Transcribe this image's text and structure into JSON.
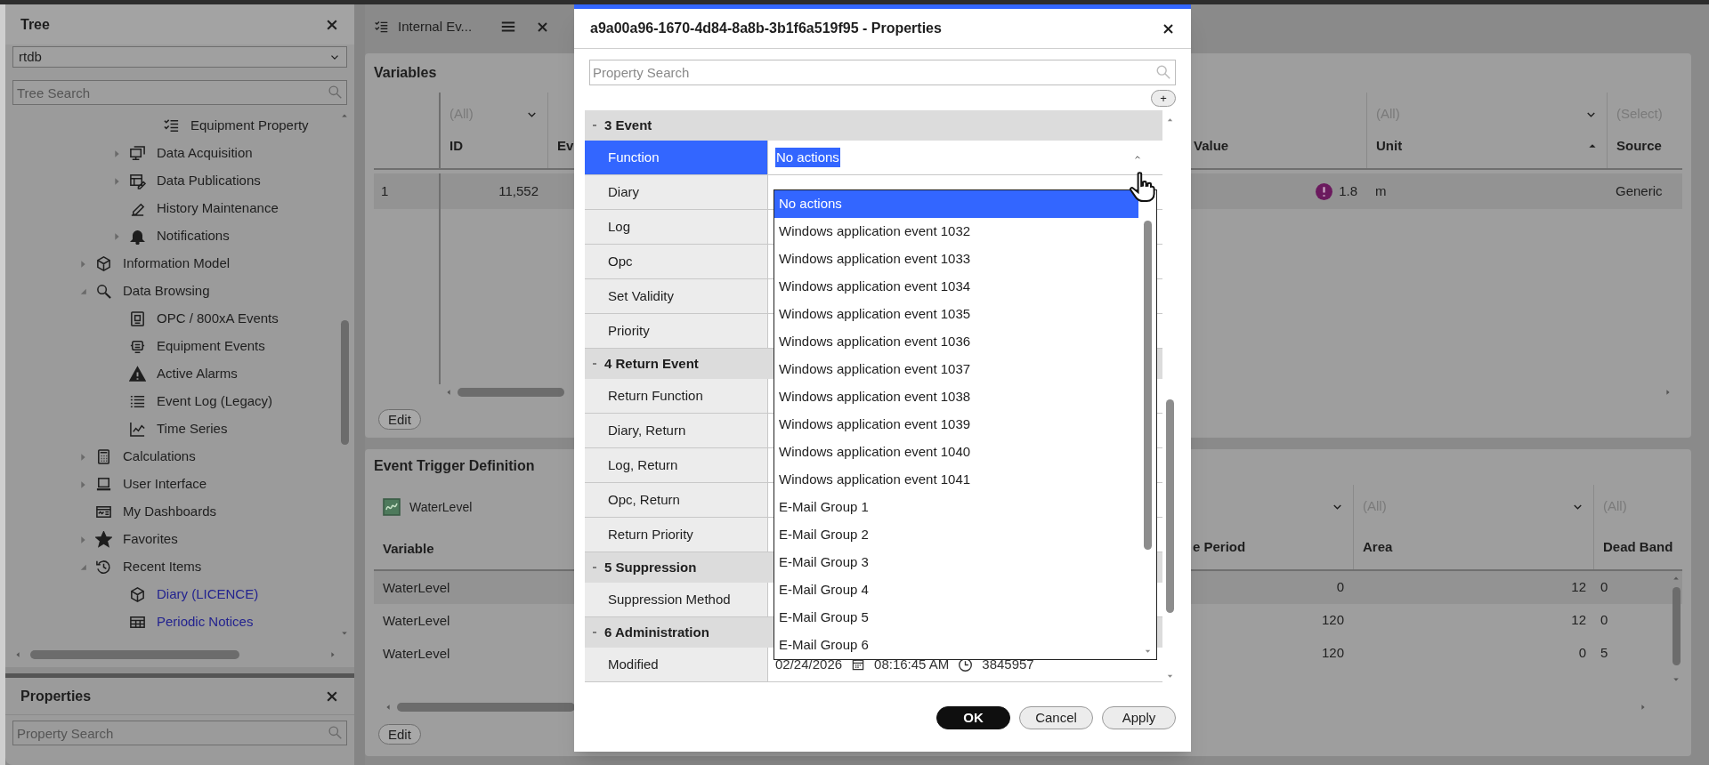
{
  "tree_panel": {
    "title": "Tree",
    "database": "rtdb",
    "search_placeholder": "Tree Search",
    "items": [
      {
        "children": [
          {
            "children": [
              {
                "label": "Equipment Property"
              }
            ]
          },
          {
            "label": "Data Acquisition",
            "expanded": false
          },
          {
            "label": "Data Publications",
            "expanded": false
          },
          {
            "label": "History Maintenance"
          },
          {
            "label": "Notifications",
            "expanded": false
          }
        ]
      },
      {
        "label": "Information Model",
        "expanded": false
      },
      {
        "label": "Data Browsing",
        "expanded": true,
        "children": [
          {
            "label": "OPC / 800xA Events"
          },
          {
            "label": "Equipment Events"
          },
          {
            "label": "Active Alarms"
          },
          {
            "label": "Event Log (Legacy)"
          },
          {
            "label": "Time Series"
          }
        ]
      },
      {
        "label": "Calculations",
        "expanded": false
      },
      {
        "label": "User Interface",
        "expanded": false
      },
      {
        "label": "My Dashboards"
      },
      {
        "label": "Favorites",
        "expanded": false
      },
      {
        "label": "Recent Items",
        "expanded": true,
        "children": [
          {
            "label": "Diary (LICENCE)",
            "kind": "link"
          },
          {
            "label": "Periodic Notices",
            "kind": "link"
          }
        ]
      }
    ]
  },
  "properties_panel": {
    "title": "Properties",
    "search_placeholder": "Property Search"
  },
  "tab": {
    "label": "Internal Ev..."
  },
  "variables": {
    "title": "Variables",
    "columns": [
      {
        "label": "ID",
        "filter": "(All)",
        "dropdown": true
      },
      {
        "label": "Ev"
      },
      {
        "label": "Value"
      },
      {
        "label": "Unit",
        "filter": "(All)",
        "dropdown": true,
        "sorted": true
      },
      {
        "label": "Source",
        "filter": "(Select)"
      }
    ],
    "rows": [
      {
        "number": "1",
        "id": "11,552",
        "alarm": true,
        "value": "1.8",
        "unit": "m",
        "source": "Generic",
        "selected": true
      }
    ],
    "edit_button": "Edit"
  },
  "event_trigger": {
    "title": "Event Trigger Definition",
    "variable_filter": "WaterLevel",
    "columns": [
      {
        "label": "Variable"
      },
      {
        "label": "e Period",
        "dropdown": true
      },
      {
        "label": "Area",
        "filter": "(All)",
        "dropdown": true
      },
      {
        "label": "Dead Band",
        "filter": "(All)"
      }
    ],
    "rows": [
      {
        "variable": "WaterLevel",
        "period": "0",
        "area": "12",
        "dead_band": "0",
        "selected": true
      },
      {
        "variable": "WaterLevel",
        "period": "120",
        "area": "12",
        "dead_band": "0",
        "selected": false
      },
      {
        "variable": "WaterLevel",
        "period": "120",
        "area": "0",
        "dead_band": "5",
        "selected": false
      }
    ],
    "edit_button": "Edit"
  },
  "dialog": {
    "title": "a9a00a96-1670-4d84-8a8b-3b1f6a519f95 - Properties",
    "search_placeholder": "Property Search",
    "add_button": "+",
    "groups": [
      {
        "label": "3 Event",
        "expanded": true,
        "rows": [
          {
            "label": "Function",
            "selected": true,
            "value": "No actions"
          },
          {
            "label": "Diary",
            "selected": false
          },
          {
            "label": "Log",
            "selected": false
          },
          {
            "label": "Opc",
            "selected": false
          },
          {
            "label": "Set Validity",
            "selected": false
          },
          {
            "label": "Priority",
            "selected": false
          }
        ]
      },
      {
        "label": "4 Return Event",
        "expanded": true,
        "rows": [
          {
            "label": "Return Function",
            "selected": false
          },
          {
            "label": "Diary, Return",
            "selected": false
          },
          {
            "label": "Log, Return",
            "selected": false
          },
          {
            "label": "Opc, Return",
            "selected": false
          },
          {
            "label": "Return Priority",
            "selected": false
          }
        ]
      },
      {
        "label": "5 Suppression",
        "expanded": true,
        "rows": [
          {
            "label": "Suppression Method",
            "selected": false
          }
        ]
      },
      {
        "label": "6 Administration",
        "expanded": true,
        "rows": [
          {
            "label": "Modified",
            "selected": false,
            "date": "02/24/2026",
            "time": "08:16:45 AM",
            "number": "3845957"
          }
        ]
      }
    ],
    "dropdown": [
      {
        "label": "No actions",
        "selected": true
      },
      {
        "label": "Windows application event 1032",
        "selected": false
      },
      {
        "label": "Windows application event 1033",
        "selected": false
      },
      {
        "label": "Windows application event 1034",
        "selected": false
      },
      {
        "label": "Windows application event 1035",
        "selected": false
      },
      {
        "label": "Windows application event 1036",
        "selected": false
      },
      {
        "label": "Windows application event 1037",
        "selected": false
      },
      {
        "label": "Windows application event 1038",
        "selected": false
      },
      {
        "label": "Windows application event 1039",
        "selected": false
      },
      {
        "label": "Windows application event 1040",
        "selected": false
      },
      {
        "label": "Windows application event 1041",
        "selected": false
      },
      {
        "label": "E-Mail Group 1",
        "selected": false
      },
      {
        "label": "E-Mail Group 2",
        "selected": false
      },
      {
        "label": "E-Mail Group 3",
        "selected": false
      },
      {
        "label": "E-Mail Group 4",
        "selected": false
      },
      {
        "label": "E-Mail Group 5",
        "selected": false
      },
      {
        "label": "E-Mail Group 6",
        "selected": false
      }
    ],
    "buttons": [
      {
        "label": "OK",
        "kind": "primary"
      },
      {
        "label": "Cancel",
        "kind": "secondary"
      },
      {
        "label": "Apply",
        "kind": "secondary"
      }
    ]
  }
}
